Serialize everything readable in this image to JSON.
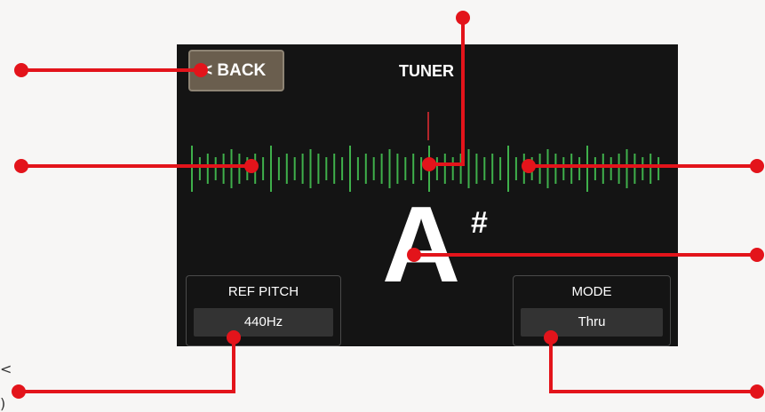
{
  "header": {
    "back_label": "< BACK",
    "title": "TUNER"
  },
  "tuner": {
    "note": "A",
    "accidental": "#",
    "meter_color": "#3fb04b",
    "marker_color": "#b3262b"
  },
  "ref_pitch": {
    "label": "REF PITCH",
    "value": "440Hz"
  },
  "mode": {
    "label": "MODE",
    "value": "Thru"
  },
  "annotation_color": "#e3141b",
  "edge_fragments": [
    "<",
    ")"
  ]
}
